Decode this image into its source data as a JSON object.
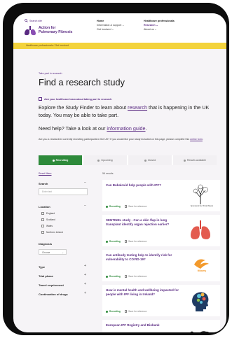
{
  "header": {
    "search_link": "Search site",
    "logo_line1": "Action for",
    "logo_line2": "Pulmonary Fibrosis",
    "nav_col1": [
      "Home",
      "Information & support",
      "Get involved"
    ],
    "nav_col2": [
      "Healthcare professionals",
      "Research",
      "About us"
    ]
  },
  "banner": {
    "text": "Healthcare professionals / Get involved"
  },
  "breadcrumb": "Take part in research",
  "page_title": "Find a research study",
  "ask_link": "Ask your healthcare team about taking part in research",
  "intro": {
    "before": "Explore the Study Finder to learn about ",
    "link": "research",
    "after": " that is happening in the UK today. You may be able to take part."
  },
  "help": {
    "before": "Need help? Take a look at our ",
    "link": "information guide",
    "after": "."
  },
  "recruiter": {
    "before": "Are you a researcher currently recruiting participants in the UK? If you would like your study included on this page, please complete this ",
    "link": "online form",
    "after": "."
  },
  "tabs": [
    {
      "label": "Recruiting",
      "active": true
    },
    {
      "label": "Upcoming",
      "active": false
    },
    {
      "label": "Closed",
      "active": false
    },
    {
      "label": "Results available",
      "active": false
    }
  ],
  "sidebar": {
    "reset": "Reset filters",
    "search_label": "Search",
    "search_placeholder": "Enter text",
    "location_label": "Location",
    "locations": [
      "England",
      "Scotland",
      "Wales",
      "Northern Ireland"
    ],
    "diagnosis_label": "Diagnosis",
    "diagnosis_value": "Choose",
    "filters": [
      "Type",
      "Trial phase",
      "Travel requirement",
      "Continuation of drugs"
    ]
  },
  "results": {
    "count": "56 results",
    "cards": [
      {
        "title": "Can Bubaloxid help people with IPF?",
        "status": "Recruiting",
        "action": "Save for reference",
        "thumb": "tree-illustration",
        "thumb_caption": "Sponsored by: Bristol Myers"
      },
      {
        "title": "SENTINEL study - Can a skin flap in lung transplant identify organ rejection earlier?",
        "status": "Recruiting",
        "action": "Save for reference",
        "thumb": "lungs-illustration",
        "thumb_caption": ""
      },
      {
        "title": "Can antibody testing help to identify risk for vulnerability to COVID-19?",
        "status": "Recruiting",
        "action": "Save for reference",
        "thumb": "bird-logo",
        "thumb_caption": "Milawny"
      },
      {
        "title": "How is mental health and wellbeing impacted for people with IPF living in Ireland?",
        "status": "Recruiting",
        "action": "Save for reference",
        "thumb": "head-illustration",
        "thumb_caption": ""
      },
      {
        "title": "European IPF Registry and Biobank",
        "status": "Recruiting",
        "action": "Save for reference",
        "thumb": "europe-map",
        "thumb_caption": ""
      }
    ]
  },
  "colors": {
    "brand_purple": "#5a2a82",
    "accent_yellow": "#f3d33c",
    "recruiting_green": "#2e8a3b",
    "device_frame": "#0d0d0d"
  }
}
